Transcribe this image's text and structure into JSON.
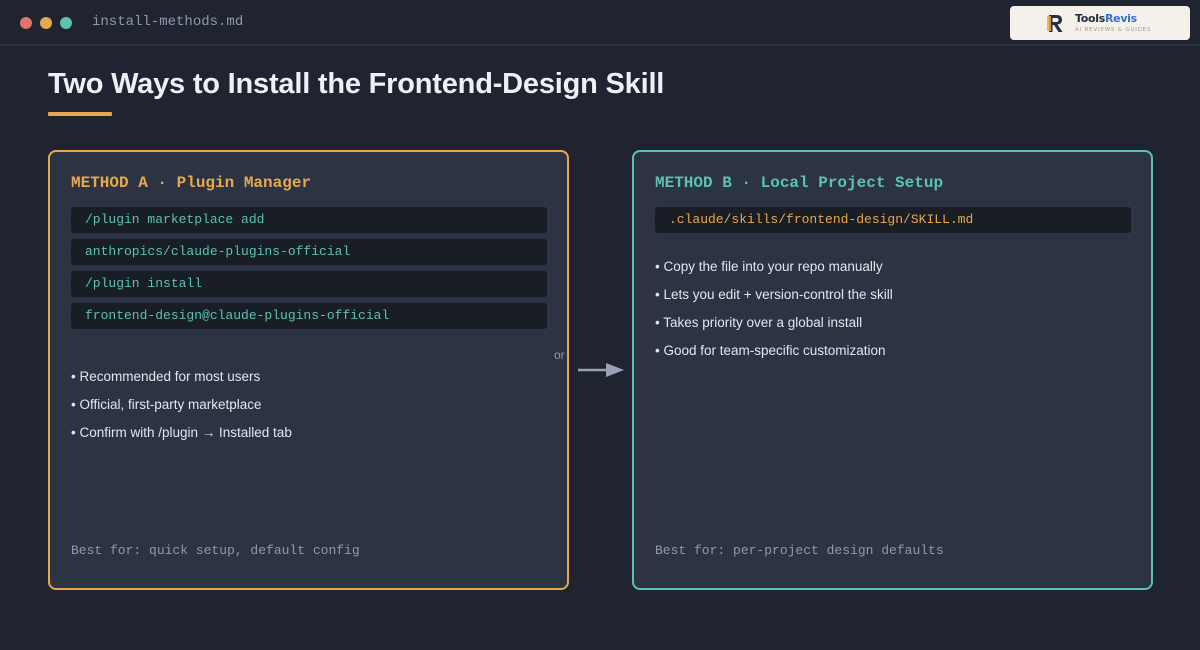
{
  "window": {
    "filename": "install-methods.md",
    "controls": [
      "close",
      "minimize",
      "maximize"
    ]
  },
  "brand": {
    "name_part1": "Tools",
    "name_part2": "Revis",
    "tagline": "AI REVIEWS & GUIDES",
    "icon": "r-monogram-logo"
  },
  "page": {
    "title": "Two Ways to Install the Frontend-Design Skill"
  },
  "connector": {
    "label": "or",
    "icon": "right-arrow-icon"
  },
  "method_a": {
    "heading": "METHOD A · Plugin Manager",
    "commands": [
      "/plugin marketplace add",
      "anthropics/claude-plugins-official",
      "/plugin install",
      "frontend-design@claude-plugins-official"
    ],
    "bullets": [
      "• Recommended for most users",
      "• Official, first-party marketplace",
      "• Confirm with /plugin → Installed tab"
    ],
    "best_for": "Best for: quick setup, default config"
  },
  "method_b": {
    "heading": "METHOD B · Local Project Setup",
    "commands": [
      ".claude/skills/frontend-design/SKILL.md"
    ],
    "bullets": [
      "• Copy the file into your repo manually",
      "• Lets you edit + version-control the skill",
      "• Takes priority over a global install",
      "• Good for team-specific customization"
    ],
    "best_for": "Best for: per-project design defaults"
  },
  "colors": {
    "background": "#1f2430",
    "card": "#2c3444",
    "accent_a": "#e7a84d",
    "accent_b": "#5cc2b0",
    "code_bg": "#191d25"
  }
}
